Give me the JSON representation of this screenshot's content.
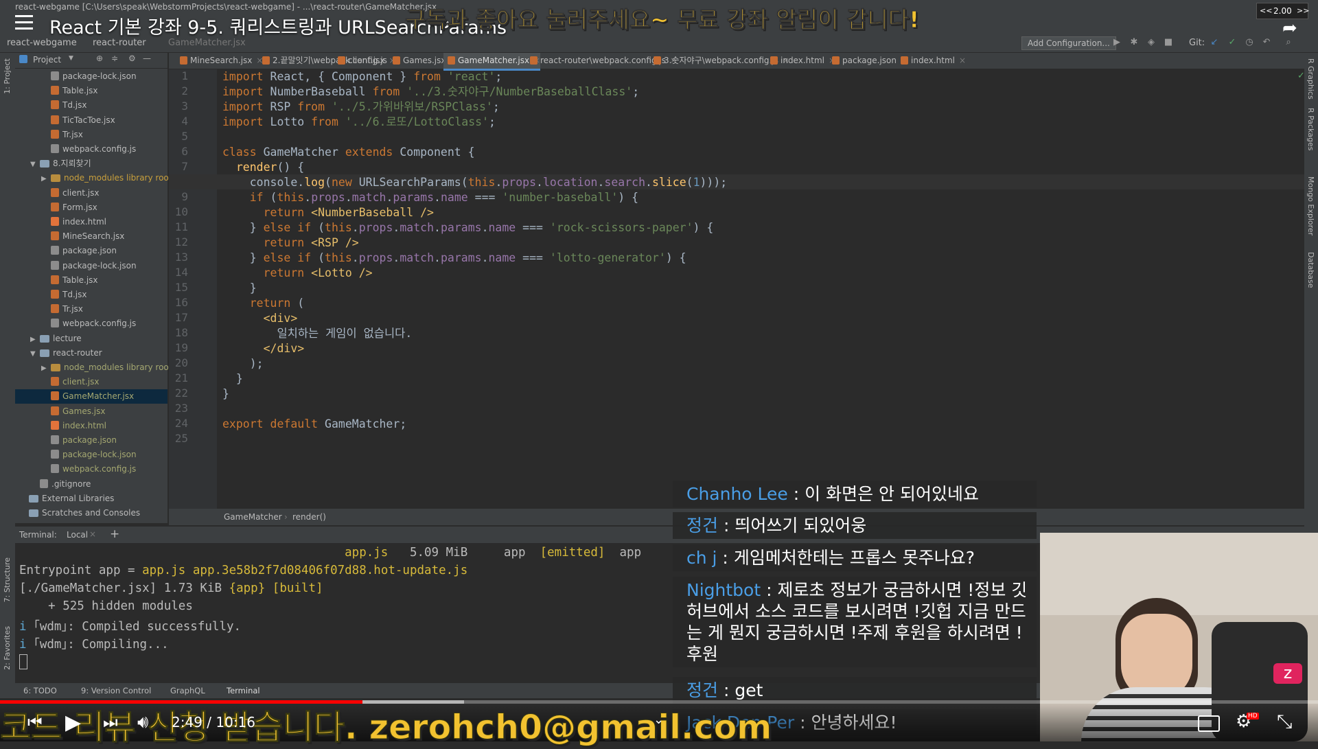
{
  "window": {
    "title": "react-webgame [C:\\Users\\speak\\WebstormProjects\\react-webgame] - ...\\react-router\\GameMatcher.jsx"
  },
  "video": {
    "title": "React 기본 강좌 9-5. 쿼리스트링과 URLSearchParams",
    "banner": "구독과 좋아요 눌러주세요~ 무료 강좌 알림이 갑니다!",
    "email_banner": "코드 리뷰 신청 받습니다. zerohch0@gmail.com",
    "speed": "2.00",
    "time": "2:49 / 10:16",
    "progress": 0.275,
    "buffered": 0.352
  },
  "navbar": {
    "crumbs": [
      "react-webgame",
      "react-router",
      "GameMatcher.jsx"
    ],
    "add_config": "Add Configuration...",
    "git_label": "Git:"
  },
  "project_panel": {
    "header": "Project",
    "rows": [
      {
        "label": "package-lock.json",
        "type": "json",
        "indent": 2
      },
      {
        "label": "Table.jsx",
        "type": "js",
        "indent": 2
      },
      {
        "label": "Td.jsx",
        "type": "js",
        "indent": 2
      },
      {
        "label": "TicTacToe.jsx",
        "type": "js",
        "indent": 2
      },
      {
        "label": "Tr.jsx",
        "type": "js",
        "indent": 2
      },
      {
        "label": "webpack.config.js",
        "type": "json",
        "indent": 2
      },
      {
        "label": "8.지뢰찾기",
        "type": "folder",
        "indent": 1,
        "open": true
      },
      {
        "label": "node_modules  library root",
        "type": "lib",
        "indent": 2,
        "closed": true
      },
      {
        "label": "client.jsx",
        "type": "js",
        "indent": 2
      },
      {
        "label": "Form.jsx",
        "type": "js",
        "indent": 2
      },
      {
        "label": "index.html",
        "type": "html",
        "indent": 2
      },
      {
        "label": "MineSearch.jsx",
        "type": "js",
        "indent": 2
      },
      {
        "label": "package.json",
        "type": "json",
        "indent": 2
      },
      {
        "label": "package-lock.json",
        "type": "json",
        "indent": 2
      },
      {
        "label": "Table.jsx",
        "type": "js",
        "indent": 2
      },
      {
        "label": "Td.jsx",
        "type": "js",
        "indent": 2
      },
      {
        "label": "Tr.jsx",
        "type": "js",
        "indent": 2
      },
      {
        "label": "webpack.config.js",
        "type": "json",
        "indent": 2
      },
      {
        "label": "lecture",
        "type": "folder",
        "indent": 1,
        "closed": true
      },
      {
        "label": "react-router",
        "type": "folder",
        "indent": 1,
        "open": true
      },
      {
        "label": "node_modules  library root",
        "type": "lib",
        "indent": 2,
        "closed": true
      },
      {
        "label": "client.jsx",
        "type": "js",
        "indent": 2
      },
      {
        "label": "GameMatcher.jsx",
        "type": "js",
        "indent": 2,
        "selected": true
      },
      {
        "label": "Games.jsx",
        "type": "js",
        "indent": 2
      },
      {
        "label": "index.html",
        "type": "html",
        "indent": 2
      },
      {
        "label": "package.json",
        "type": "json",
        "indent": 2
      },
      {
        "label": "package-lock.json",
        "type": "json",
        "indent": 2
      },
      {
        "label": "webpack.config.js",
        "type": "json",
        "indent": 2
      },
      {
        "label": ".gitignore",
        "type": "json",
        "indent": 1
      },
      {
        "label": "External Libraries",
        "type": "folder",
        "indent": 0
      },
      {
        "label": "Scratches and Consoles",
        "type": "folder",
        "indent": 0
      }
    ]
  },
  "tabs": [
    {
      "label": "MineSearch.jsx"
    },
    {
      "label": "2.끝말잇기\\webpack.config.js"
    },
    {
      "label": "client.jsx"
    },
    {
      "label": "Games.jsx"
    },
    {
      "label": "GameMatcher.jsx",
      "active": true
    },
    {
      "label": "react-router\\webpack.config.js"
    },
    {
      "label": "3.숫자야구\\webpack.config.js"
    },
    {
      "label": "index.html"
    },
    {
      "label": "package.json"
    },
    {
      "label": "index.html"
    }
  ],
  "code_lines": [
    "import React, { Component } from 'react';",
    "import NumberBaseball from '../3.숫자야구/NumberBaseballClass';",
    "import RSP from '../5.가위바위보/RSPClass';",
    "import Lotto from '../6.로또/LottoClass';",
    "",
    "class GameMatcher extends Component {",
    "  render() {",
    "    console.log(new URLSearchParams(this.props.location.search.slice(1)));",
    "    if (this.props.match.params.name === 'number-baseball') {",
    "      return <NumberBaseball />",
    "    } else if (this.props.match.params.name === 'rock-scissors-paper') {",
    "      return <RSP />",
    "    } else if (this.props.match.params.name === 'lotto-generator') {",
    "      return <Lotto />",
    "    }",
    "    return (",
    "      <div>",
    "        일치하는 게임이 없습니다.",
    "      </div>",
    "    );",
    "  }",
    "}",
    "",
    "export default GameMatcher;",
    ""
  ],
  "code_breadcrumb": [
    "GameMatcher",
    "render()"
  ],
  "terminal": {
    "label": "Terminal:",
    "tab": "Local",
    "lines": [
      "                                             app.js   5.09 MiB     app  [emitted]  app",
      "Entrypoint app = app.js app.3e58b2f7d08406f07d88.hot-update.js",
      "[./GameMatcher.jsx] 1.73 KiB {app} [built]",
      "    + 525 hidden modules",
      "i ｢wdm｣: Compiled successfully.",
      "i ｢wdm｣: Compiling..."
    ]
  },
  "bottom_tools": [
    "6: TODO",
    "9: Version Control",
    "GraphQL",
    "Terminal"
  ],
  "left_strip": [
    "1: Project",
    "7: Structure",
    "2: Favorites"
  ],
  "right_strip": [
    "R Graphics",
    "R Packages",
    "Mongo Explorer",
    "Database"
  ],
  "chat": [
    {
      "name": "Chanho Lee",
      "text": "이 화면은 안 되어있네요"
    },
    {
      "name": "정건",
      "text": "띄어쓰기 되있어웅"
    },
    {
      "name": "ch j",
      "text": "게임메처한테는 프롭스 못주나요?"
    },
    {
      "name": "Nightbot",
      "text": "제로초 정보가 궁금하시면 !정보 깃허브에서 소스 코드를 보시려면 !깃헙 지금 만드는 게 뭔지 궁금하시면 !주제 후원을 하시려면 !후원"
    },
    {
      "name": "정건",
      "text": "get"
    },
    {
      "name": "Jack Den Per",
      "text": "안녕하세요!"
    }
  ]
}
